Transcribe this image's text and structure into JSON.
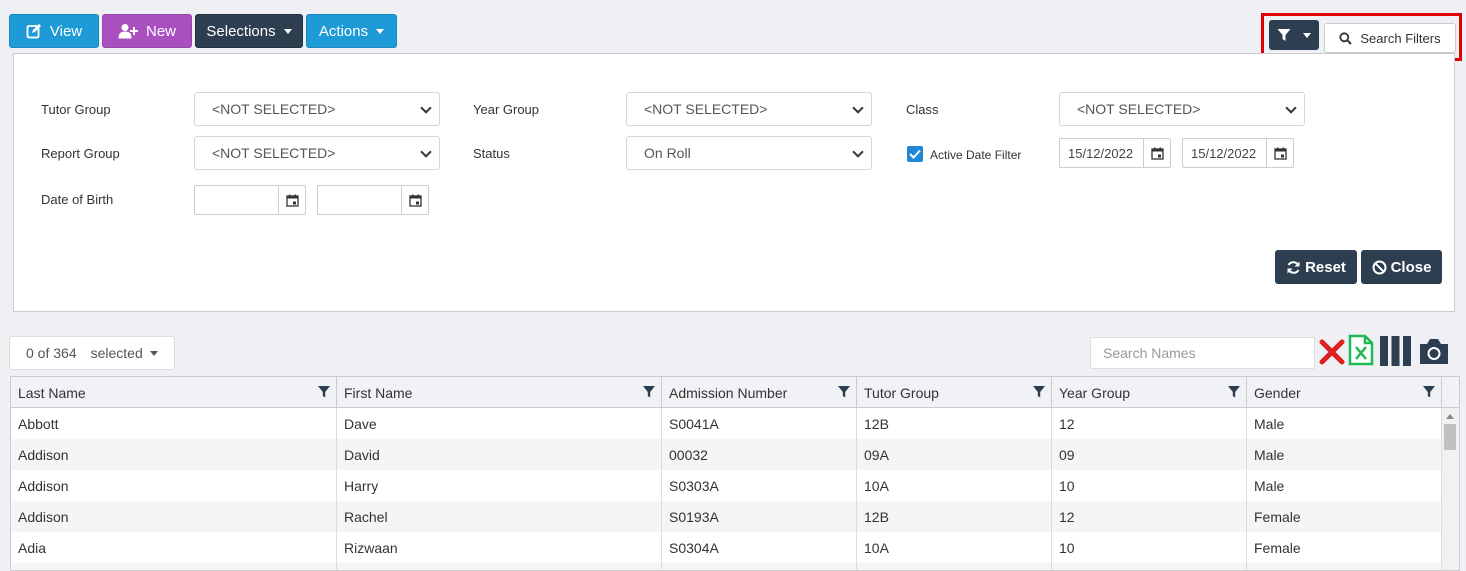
{
  "toolbar": {
    "view_label": "View",
    "new_label": "New",
    "selections_label": "Selections",
    "actions_label": "Actions",
    "search_filters_label": "Search Filters"
  },
  "filters": {
    "tutor_group": {
      "label": "Tutor Group",
      "value": "<NOT SELECTED>"
    },
    "year_group": {
      "label": "Year Group",
      "value": "<NOT SELECTED>"
    },
    "class": {
      "label": "Class",
      "value": "<NOT SELECTED>"
    },
    "report_group": {
      "label": "Report Group",
      "value": "<NOT SELECTED>"
    },
    "status": {
      "label": "Status",
      "value": "On Roll"
    },
    "active_date_filter": {
      "label": "Active Date Filter",
      "checked": true,
      "from": "15/12/2022",
      "to": "15/12/2022"
    },
    "date_of_birth": {
      "label": "Date of Birth",
      "from": "",
      "to": ""
    },
    "reset_label": "Reset",
    "close_label": "Close"
  },
  "grid_tools": {
    "count_text": "0 of 364",
    "selected_label": "selected",
    "search_placeholder": "Search Names"
  },
  "table": {
    "columns": [
      "Last Name",
      "First Name",
      "Admission Number",
      "Tutor Group",
      "Year Group",
      "Gender"
    ],
    "rows": [
      [
        "Abbott",
        "Dave",
        "S0041A",
        "12B",
        "12",
        "Male"
      ],
      [
        "Addison",
        "David",
        "00032",
        "09A",
        "09",
        "Male"
      ],
      [
        "Addison",
        "Harry",
        "S0303A",
        "10A",
        "10",
        "Male"
      ],
      [
        "Addison",
        "Rachel",
        "S0193A",
        "12B",
        "12",
        "Female"
      ],
      [
        "Adia",
        "Rizwaan",
        "S0304A",
        "10A",
        "10",
        "Female"
      ],
      [
        "",
        "",
        "",
        "",
        "",
        ""
      ]
    ]
  },
  "colors": {
    "primary_blue": "#1e9ad6",
    "purple": "#a94fbf",
    "dark_navy": "#2c3e50",
    "highlight_red": "#e00000",
    "excel_green": "#1db954",
    "delete_red": "#e02020"
  },
  "icons": [
    "edit-icon",
    "user-plus-icon",
    "filter-icon",
    "search-icon",
    "calendar-icon",
    "refresh-icon",
    "ban-icon",
    "clear-x-icon",
    "excel-icon",
    "columns-icon",
    "camera-icon"
  ]
}
